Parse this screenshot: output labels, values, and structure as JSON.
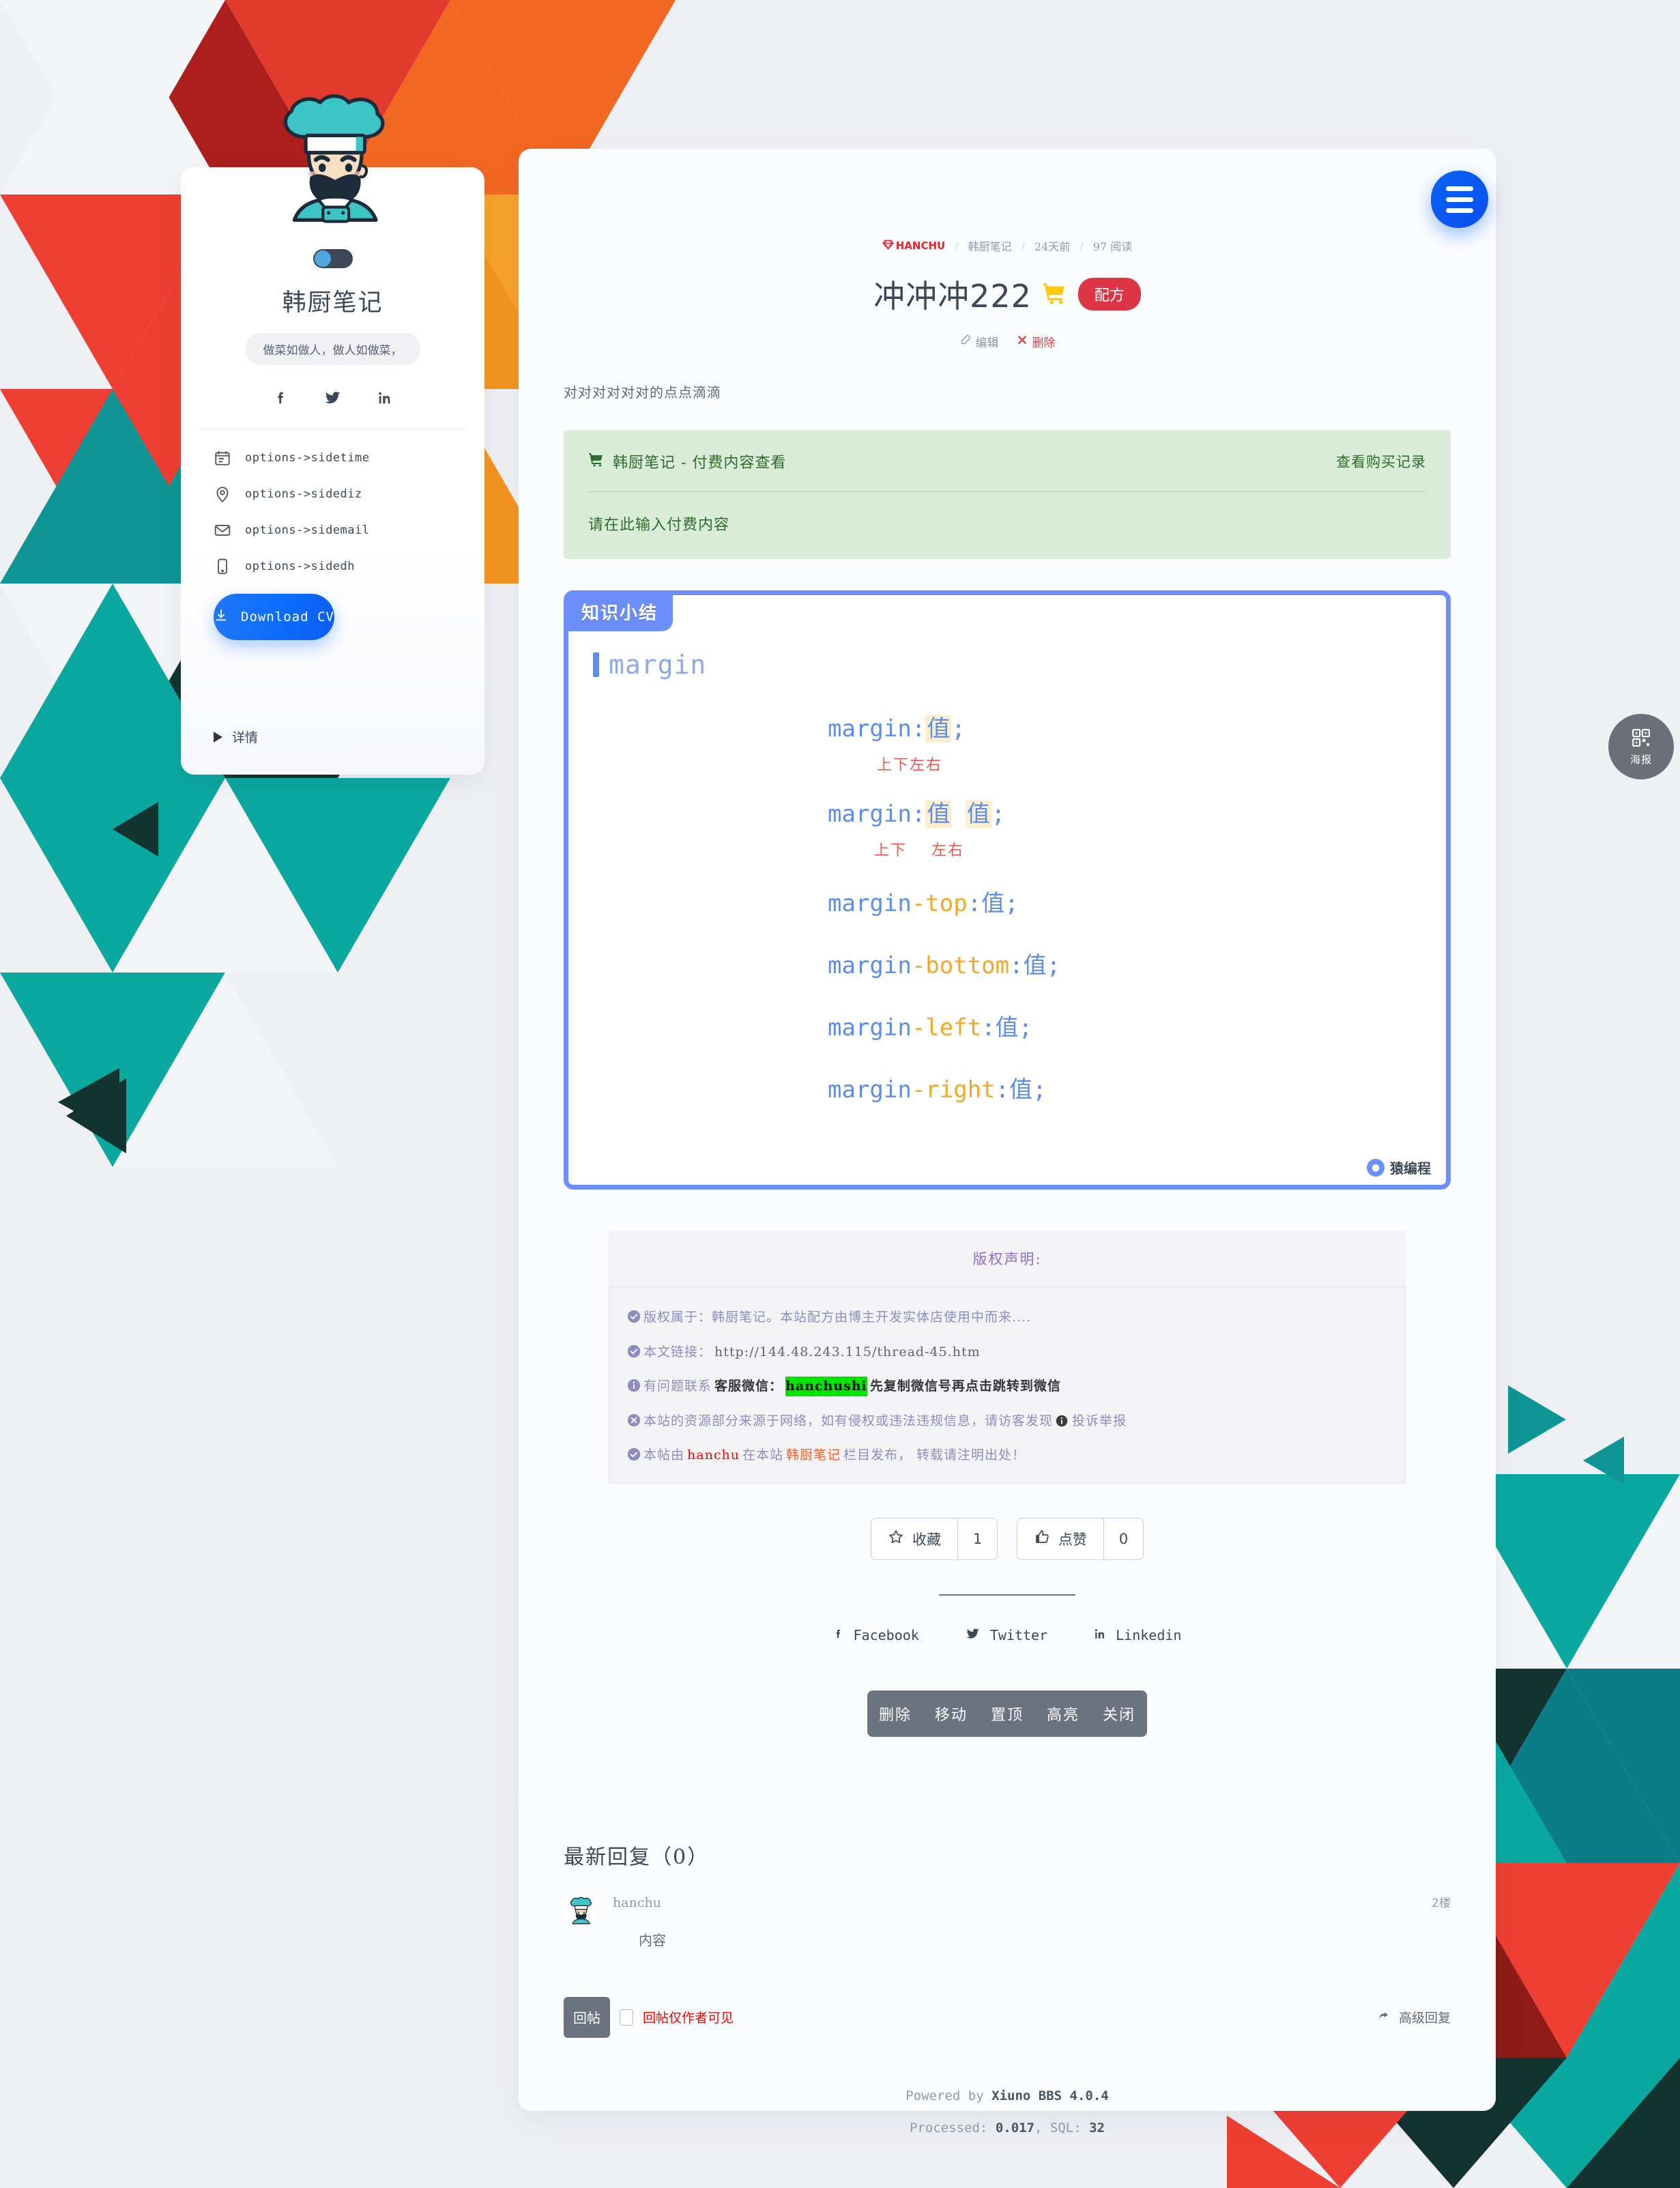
{
  "profile": {
    "avatar_icon": "chef-avatar",
    "toggle_icon": "theme-toggle",
    "name": "韩厨笔记",
    "quote": "做菜如做人，做人如做菜，",
    "socials": [
      {
        "icon": "facebook-icon",
        "name": "facebook"
      },
      {
        "icon": "twitter-icon",
        "name": "twitter"
      },
      {
        "icon": "linkedin-icon",
        "name": "linkedin"
      }
    ],
    "options": [
      {
        "icon": "calendar-icon",
        "label": "options->sidetime"
      },
      {
        "icon": "location-pin-icon",
        "label": "options->sidediz"
      },
      {
        "icon": "envelope-icon",
        "label": "options->sidemail"
      },
      {
        "icon": "mobile-phone-icon",
        "label": "options->sidedh"
      }
    ],
    "cv_button": "Download CV",
    "cv_icon": "download-icon",
    "details_label": "详情"
  },
  "header": {
    "brand": "HANCHU",
    "brand_icon": "diamond-icon",
    "breadcrumbs": [
      "韩厨笔记",
      "24天前",
      "97 阅读"
    ],
    "title": "冲冲冲222",
    "cart_icon": "shopping-cart-icon",
    "category_badge": "配方",
    "edit_label": "编辑",
    "edit_icon": "edit-pencil-icon",
    "delete_label": "删除",
    "delete_icon": "x-mark-icon"
  },
  "post": {
    "text": "对对对对对对的点点滴滴"
  },
  "paid": {
    "cart_icon": "cart-icon",
    "title": "韩厨笔记 - 付费内容查看",
    "records_link": "查看购买记录",
    "placeholder_text": "请在此输入付费内容"
  },
  "code_card": {
    "badge": "知识小结",
    "layers_icon": "layers-icon",
    "heading": "margin",
    "lines": [
      {
        "kw": "margin",
        "sub": "",
        "value_count": 1,
        "note": "上下左右"
      },
      {
        "kw": "margin",
        "sub": "",
        "value_count": 2,
        "note_a": "上下",
        "note_b": "左右"
      },
      {
        "kw": "margin",
        "sub": "-top",
        "value_count": 1,
        "note": ""
      },
      {
        "kw": "margin",
        "sub": "-bottom",
        "value_count": 1,
        "note": ""
      },
      {
        "kw": "margin",
        "sub": "-left",
        "value_count": 1,
        "note": ""
      },
      {
        "kw": "margin",
        "sub": "-right",
        "value_count": 1,
        "note": ""
      }
    ],
    "value_token": "值",
    "watermark": "猿编程",
    "watermark_icon": "monkey-avatar-icon"
  },
  "copyright": {
    "heading": "版权声明:",
    "rows": [
      {
        "icon": "check-circle-icon",
        "text": "版权属于：韩厨笔记。本站配方由博主开发实体店使用中而来...."
      },
      {
        "icon": "check-circle-icon",
        "text": "本文链接：",
        "link": "http://144.48.243.115/thread-45.htm"
      },
      {
        "icon": "info-circle-icon",
        "prefix": "有问题联系",
        "strong": "客服微信：",
        "highlight": "hanchushi",
        "suffix": "先复制微信号再点击跳转到微信"
      },
      {
        "icon": "x-circle-icon",
        "text": "本站的资源部分来源于网络，如有侵权或违法违规信息，请访客发现",
        "badge_icon": "info-dark-icon",
        "tail": " 投诉举报"
      },
      {
        "icon": "check-circle-icon",
        "pre": "本帖由",
        "author": "hanchu",
        "mid": "在本站",
        "column": "韩厨笔记",
        "post": "栏目发布， 转载请注明出处！"
      }
    ]
  },
  "engagement": {
    "favorite_label": "收藏",
    "favorite_icon": "star-icon",
    "favorite_count": "1",
    "like_label": "点赞",
    "like_icon": "thumbs-up-icon",
    "like_count": "0"
  },
  "share": [
    {
      "icon": "facebook-icon",
      "label": "Facebook"
    },
    {
      "icon": "twitter-icon",
      "label": "Twitter"
    },
    {
      "icon": "linkedin-icon",
      "label": "Linkedin"
    }
  ],
  "admin_bar": [
    "删除",
    "移动",
    "置顶",
    "高亮",
    "关闭"
  ],
  "replies": {
    "heading": "最新回复（0）",
    "items": [
      {
        "avatar_icon": "chef-avatar-small",
        "user": "hanchu",
        "floor": "2楼",
        "content": "内容"
      }
    ],
    "reply_button": "回帖",
    "checkbox_label": "回帖仅作者可见",
    "advanced_label": "高级回复",
    "advanced_icon": "arrow-reply-icon"
  },
  "floating": {
    "menu_icon": "hamburger-menu-icon",
    "qr_icon": "qr-code-icon",
    "qr_label": "海报"
  },
  "footer": {
    "powered_prefix": "Powered by ",
    "powered_name": "Xiuno BBS 4.0.4",
    "processed_prefix": "Processed: ",
    "processed_value": "0.017",
    "sql_prefix": ", SQL: ",
    "sql_value": "32"
  },
  "colors": {
    "accent_blue": "#0d6efd",
    "brand_red": "#f01f2e",
    "badge_red": "#dc3545",
    "paid_green": "#d9ecd7",
    "code_blue": "#6b8efb",
    "note_red": "#f5554a",
    "highlight_green": "#00e500"
  }
}
